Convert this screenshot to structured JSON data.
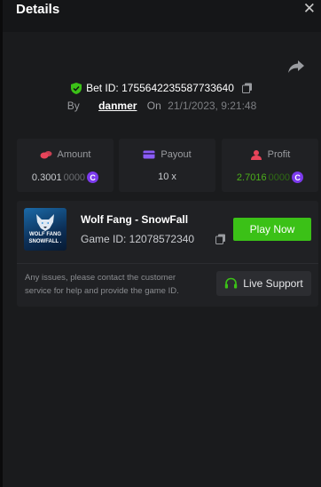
{
  "header": {
    "title": "Details",
    "close_glyph": "✕"
  },
  "bet": {
    "id_label": "Bet ID: 1755642235587733640",
    "by_label": "By",
    "username": "danmer",
    "on_label": "On",
    "datetime": "21/1/2023, 9:21:48"
  },
  "stats": {
    "amount": {
      "label": "Amount",
      "value_main": "0.3001",
      "value_dim": "0000",
      "icon": "coins-icon"
    },
    "payout": {
      "label": "Payout",
      "value": "10 x",
      "icon": "card-icon"
    },
    "profit": {
      "label": "Profit",
      "value_main": "2.7016",
      "value_dim": "0000",
      "icon": "profit-icon"
    },
    "coin_glyph": "C"
  },
  "game": {
    "thumb_title_1": "WOLF FANG",
    "thumb_title_2": "SNOWFALL .",
    "name": "Wolf Fang - SnowFall",
    "id_label": "Game ID: 12078572340",
    "play_label": "Play Now",
    "support_message": "Any issues, please contact the customer service for help and provide the game ID.",
    "support_label": "Live Support"
  },
  "colors": {
    "accent_green": "#3bc117",
    "profit_green": "#4caf1a",
    "coin_purple": "#7c3aed",
    "amount_icon": "#e8445a",
    "payout_icon": "#8b5cf6",
    "profit_icon": "#e8445a"
  }
}
